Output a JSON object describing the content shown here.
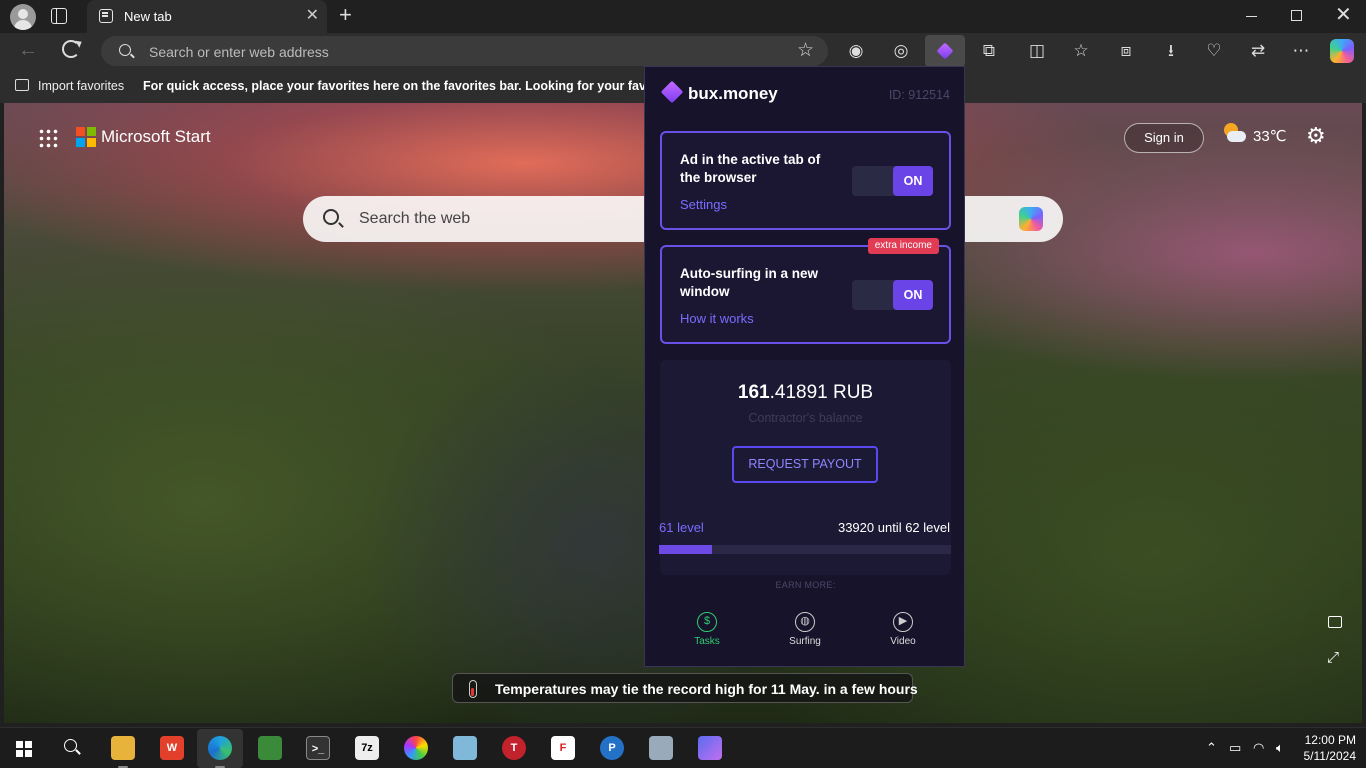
{
  "browser": {
    "tab_title": "New tab",
    "tab_close": "✕",
    "new_tab": "+",
    "window_close": "✕",
    "address_placeholder": "Search or enter web address",
    "favorites": {
      "import_label": "Import favorites",
      "hint": "For quick access, place your favorites here on the favorites bar. Looking for your favorites? G"
    }
  },
  "newtab_page": {
    "brand": "Microsoft Start",
    "search_placeholder": "Search the web",
    "sign_in": "Sign in",
    "temperature": "33℃",
    "news_headline": "Temperatures may tie the record high for 11 May. in a few hours"
  },
  "extension": {
    "brand": "bux.money",
    "user_id": "ID: 912514",
    "cards": [
      {
        "title": "Ad in the active tab of the browser",
        "link": "Settings",
        "toggle": "ON"
      },
      {
        "title": "Auto-surfing in a new window",
        "link": "How it works",
        "toggle": "ON",
        "badge": "extra income"
      }
    ],
    "balance": {
      "integer": "161",
      "fraction": ".41891 RUB",
      "label": "Contractor's balance"
    },
    "payout_button": "REQUEST PAYOUT",
    "level": {
      "current": "61 level",
      "next": "33920 until 62 level",
      "progress_fraction": 0.18
    },
    "earn_more": {
      "heading": "EARN MORE:",
      "items": [
        {
          "label": "Tasks",
          "icon": "$"
        },
        {
          "label": "Surfing",
          "icon": "◍"
        },
        {
          "label": "Video",
          "icon": "▶"
        }
      ]
    }
  },
  "taskbar": {
    "time": "12:00 PM",
    "date": "5/11/2024"
  },
  "colors": {
    "accent": "#6b44e8",
    "badge": "#e23b54",
    "active_earn": "#2ecc71"
  }
}
